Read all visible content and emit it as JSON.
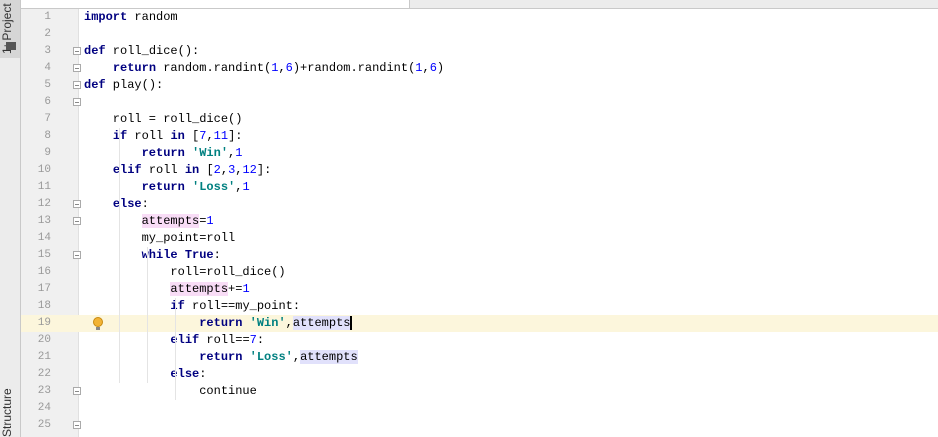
{
  "tool_windows": {
    "project": "1: Project",
    "structure": "Structure"
  },
  "editor": {
    "current_line": 19,
    "lines": [
      [
        [
          "import",
          "kw"
        ],
        [
          " random",
          ""
        ]
      ],
      [],
      [
        [
          "def",
          "kw"
        ],
        [
          " roll_dice():",
          ""
        ]
      ],
      [
        [
          "    ",
          ""
        ],
        [
          "return",
          "kw"
        ],
        [
          " random.randint(",
          ""
        ],
        [
          "1",
          "num"
        ],
        [
          ",",
          ""
        ],
        [
          "6",
          "num"
        ],
        [
          ")+random.randint(",
          ""
        ],
        [
          "1",
          "num"
        ],
        [
          ",",
          ""
        ],
        [
          "6",
          "num"
        ],
        [
          ")",
          ""
        ]
      ],
      [
        [
          "def",
          "kw"
        ],
        [
          " play():",
          ""
        ]
      ],
      [],
      [
        [
          "    roll = roll_dice()",
          ""
        ]
      ],
      [
        [
          "    ",
          ""
        ],
        [
          "if",
          "kw"
        ],
        [
          " roll ",
          ""
        ],
        [
          "in",
          "kw"
        ],
        [
          " [",
          ""
        ],
        [
          "7",
          "num"
        ],
        [
          ",",
          ""
        ],
        [
          "11",
          "num"
        ],
        [
          "]:",
          ""
        ]
      ],
      [
        [
          "        ",
          ""
        ],
        [
          "return",
          "kw"
        ],
        [
          " ",
          ""
        ],
        [
          "'Win'",
          "str"
        ],
        [
          ",",
          ""
        ],
        [
          "1",
          "num"
        ]
      ],
      [
        [
          "    ",
          ""
        ],
        [
          "elif",
          "kw"
        ],
        [
          " roll ",
          ""
        ],
        [
          "in",
          "kw"
        ],
        [
          " [",
          ""
        ],
        [
          "2",
          "num"
        ],
        [
          ",",
          ""
        ],
        [
          "3",
          "num"
        ],
        [
          ",",
          ""
        ],
        [
          "12",
          "num"
        ],
        [
          "]:",
          ""
        ]
      ],
      [
        [
          "        ",
          ""
        ],
        [
          "return",
          "kw"
        ],
        [
          " ",
          ""
        ],
        [
          "'Loss'",
          "str"
        ],
        [
          ",",
          ""
        ],
        [
          "1",
          "num"
        ]
      ],
      [
        [
          "    ",
          ""
        ],
        [
          "else",
          "kw"
        ],
        [
          ":",
          ""
        ]
      ],
      [
        [
          "        ",
          ""
        ],
        [
          "attempts",
          "hl"
        ],
        [
          "=",
          ""
        ],
        [
          "1",
          "num"
        ]
      ],
      [
        [
          "        my_point=roll",
          ""
        ]
      ],
      [
        [
          "        ",
          ""
        ],
        [
          "while",
          "kw"
        ],
        [
          " ",
          ""
        ],
        [
          "True",
          "kw"
        ],
        [
          ":",
          ""
        ]
      ],
      [
        [
          "            roll=roll_dice()",
          ""
        ]
      ],
      [
        [
          "            ",
          ""
        ],
        [
          "attempts",
          "hl"
        ],
        [
          "+=",
          ""
        ],
        [
          "1",
          "num"
        ]
      ],
      [
        [
          "            ",
          ""
        ],
        [
          "if",
          "kw"
        ],
        [
          " roll==my_point:",
          ""
        ]
      ],
      [
        [
          "                ",
          ""
        ],
        [
          "return",
          "kw"
        ],
        [
          " ",
          ""
        ],
        [
          "'Win'",
          "str"
        ],
        [
          ",",
          ""
        ],
        [
          "attempts",
          "hl2 caret"
        ]
      ],
      [
        [
          "            ",
          ""
        ],
        [
          "elif",
          "kw"
        ],
        [
          " roll==",
          ""
        ],
        [
          "7",
          "num"
        ],
        [
          ":",
          ""
        ]
      ],
      [
        [
          "                ",
          ""
        ],
        [
          "return",
          "kw"
        ],
        [
          " ",
          ""
        ],
        [
          "'Loss'",
          "str"
        ],
        [
          ",",
          ""
        ],
        [
          "attempts",
          "hl2"
        ]
      ],
      [
        [
          "            ",
          ""
        ],
        [
          "else",
          "kw"
        ],
        [
          ":",
          ""
        ]
      ],
      [
        [
          "                continue",
          ""
        ]
      ],
      [],
      []
    ],
    "fold_lines": [
      3,
      4,
      5,
      6,
      12,
      13,
      15,
      23,
      25
    ]
  }
}
